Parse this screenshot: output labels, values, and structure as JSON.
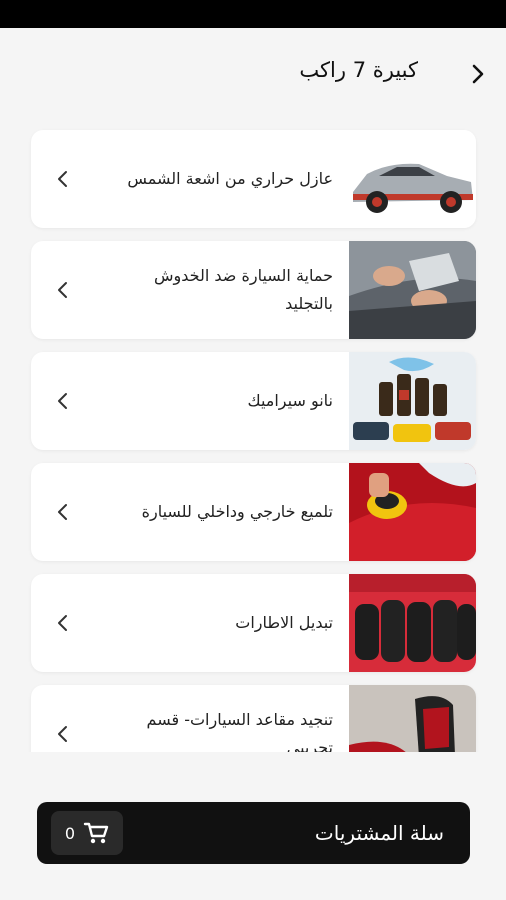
{
  "header": {
    "title": "كبيرة 7 راكب"
  },
  "services": [
    {
      "label": "عازل حراري من اشعة الشمس",
      "image": "sports-car-image"
    },
    {
      "label": "حماية السيارة ضد الخدوش بالتجليد",
      "image": "car-wrap-image"
    },
    {
      "label": "نانو سيراميك",
      "image": "nano-ceramic-image"
    },
    {
      "label": "تلميع خارجي وداخلي للسيارة",
      "image": "car-polish-image"
    },
    {
      "label": "تبديل الاطارات",
      "image": "tires-image"
    },
    {
      "label": "تنجيد مقاعد السيارات- قسم تجريبي",
      "image": "car-seat-image"
    }
  ],
  "cart": {
    "label": "سلة المشتريات",
    "count": "0"
  }
}
